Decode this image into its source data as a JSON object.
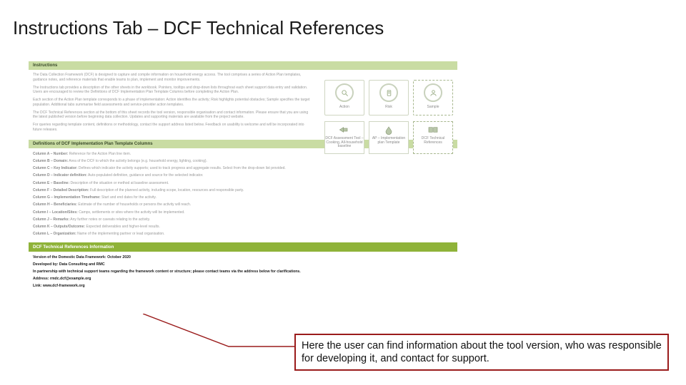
{
  "slide": {
    "title": "Instructions Tab – DCF Technical References"
  },
  "doc": {
    "sections": {
      "instructions": {
        "header": "Instructions",
        "p1": "The Data Collection Framework (DCF) is designed to capture and compile information on household energy access. The tool comprises a series of Action Plan templates, guidance notes, and reference materials that enable teams to plan, implement and monitor improvements.",
        "p2": "The Instructions tab provides a description of the other sheets in the workbook. Pointers, tooltips and drop-down lists throughout each sheet support data entry and validation. Users are encouraged to review the Definitions of DCF Implementation Plan Template Columns before completing the Action Plan.",
        "p3": "Each section of the Action Plan template corresponds to a phase of implementation: Action identifies the activity; Risk highlights potential obstacles; Sample specifies the target population. Additional tabs summarise field assessments and service-provider action templates.",
        "p4": "The DCF Technical References section at the bottom of this sheet records the tool version, responsible organisation and contact information. Please ensure that you are using the latest published version before beginning data collection. Updates and supporting materials are available from the project website.",
        "p5": "For queries regarding template content, definitions or methodology, contact the support address listed below. Feedback on usability is welcome and will be incorporated into future releases."
      },
      "tiles": {
        "action": "Action",
        "risk": "Risk",
        "sample": "Sample",
        "assessment": "DCF Assessment Tool – Cooking, All-household baseline",
        "actionplan": "AP – Implementation plan Template",
        "techref": "DCF Technical References"
      },
      "coldefs": {
        "header": "Definitions of DCF Implementation Plan Template Columns",
        "items": [
          {
            "k": "Column A – Number:",
            "v": "Reference for the Action Plan line item."
          },
          {
            "k": "Column B – Domain:",
            "v": "Area of the DCF to which the activity belongs (e.g. household energy, lighting, cooking)."
          },
          {
            "k": "Column C – Key Indicator:",
            "v": "Defines which indicator the activity supports; used to track progress and aggregate results. Select from the drop-down list provided."
          },
          {
            "k": "Column D – Indicator definition:",
            "v": "Auto-populated definition, guidance and source for the selected indicator."
          },
          {
            "k": "Column E – Baseline:",
            "v": "Description of the situation or method at baseline assessment."
          },
          {
            "k": "Column F – Detailed Description:",
            "v": "Full description of the planned activity, including scope, location, resources and responsible party."
          },
          {
            "k": "Column G – Implementation Timeframe:",
            "v": "Start and end dates for the activity."
          },
          {
            "k": "Column H – Beneficiaries:",
            "v": "Estimate of the number of households or persons the activity will reach."
          },
          {
            "k": "Column I – Location/Sites:",
            "v": "Camps, settlements or sites where the activity will be implemented."
          },
          {
            "k": "Column J – Remarks:",
            "v": "Any further notes or caveats relating to the activity."
          },
          {
            "k": "Column K – Outputs/Outcome:",
            "v": "Expected deliverables and higher-level results."
          },
          {
            "k": "Column L – Organization:",
            "v": "Name of the implementing partner or lead organisation."
          }
        ]
      },
      "techref": {
        "header": "DCF Technical References Information",
        "l1": "Version of the Domestic Data Framework: October 2020",
        "l2": "Developed by: Data Consulting and RMC",
        "l3": "In partnership with technical support teams regarding the framework content or structure; please contact teams via the address below for clarifications.",
        "l4": "Address: rmdc.dcf@example.org",
        "l5": "Link: www.dcf-framework.org"
      }
    }
  },
  "callout": {
    "text": "Here the user can find information about the tool version, who was responsible for developing it, and contact for support."
  }
}
